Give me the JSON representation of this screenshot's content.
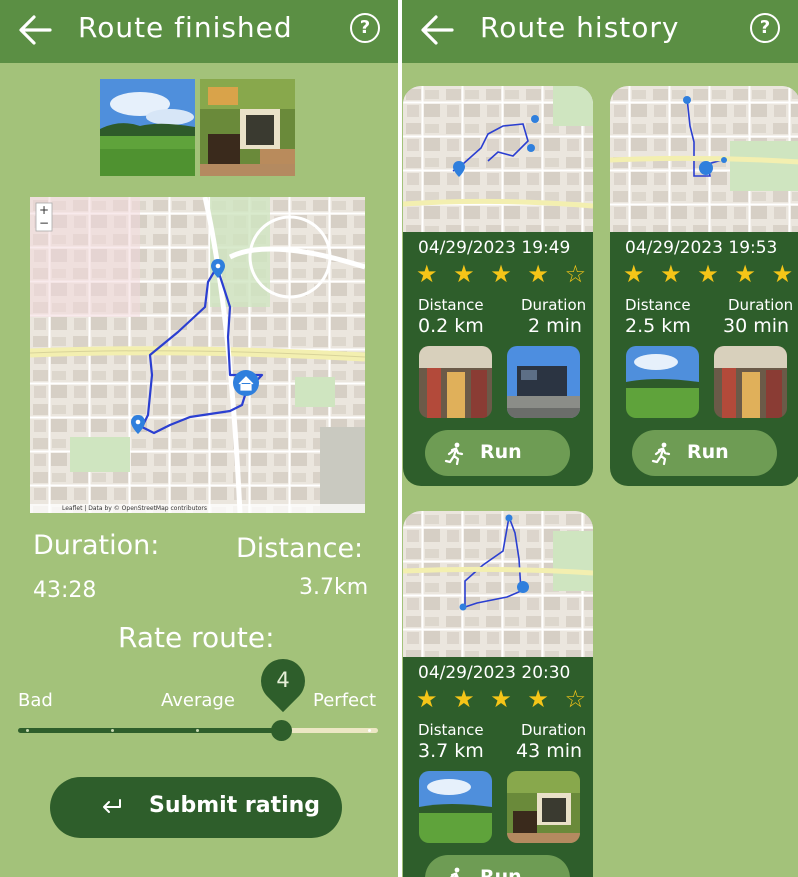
{
  "left_screen": {
    "title": "Route finished",
    "duration_label": "Duration:",
    "duration_value": "43:28",
    "distance_label": "Distance:",
    "distance_value": "3.7km",
    "rate_heading": "Rate route:",
    "slider": {
      "label_bad": "Bad",
      "label_average": "Average",
      "label_perfect": "Perfect",
      "value": 4,
      "value_text": "4",
      "max": 5
    },
    "submit_label": "Submit rating",
    "map_attribution": "Leaflet | Data by © OpenStreetMap contributors"
  },
  "right_screen": {
    "title": "Route history",
    "distance_label": "Distance",
    "duration_label": "Duration",
    "run_label": "Run",
    "cards": [
      {
        "date": "04/29/2023 19:49",
        "stars": "★ ★ ★ ★ ☆",
        "rating": 4,
        "distance": "0.2 km",
        "duration": "2 min"
      },
      {
        "date": "04/29/2023 19:53",
        "stars": "★ ★ ★ ★ ★",
        "rating": 5,
        "distance": "2.5 km",
        "duration": "30 min"
      },
      {
        "date": "04/29/2023 20:30",
        "stars": "★ ★ ★ ★ ☆",
        "rating": 4,
        "distance": "3.7 km",
        "duration": "43 min"
      }
    ]
  },
  "colors": {
    "background": "#a3c27a",
    "appbar": "#5b8f44",
    "dark_green": "#2e5e2b",
    "star": "#f5c518",
    "route": "#2b3fd1",
    "marker": "#2f7fdd"
  },
  "icons": [
    "back-arrow-icon",
    "help-icon",
    "enter-arrow-icon",
    "running-person-icon",
    "map-pin-icon",
    "home-marker-icon",
    "star-icon"
  ]
}
